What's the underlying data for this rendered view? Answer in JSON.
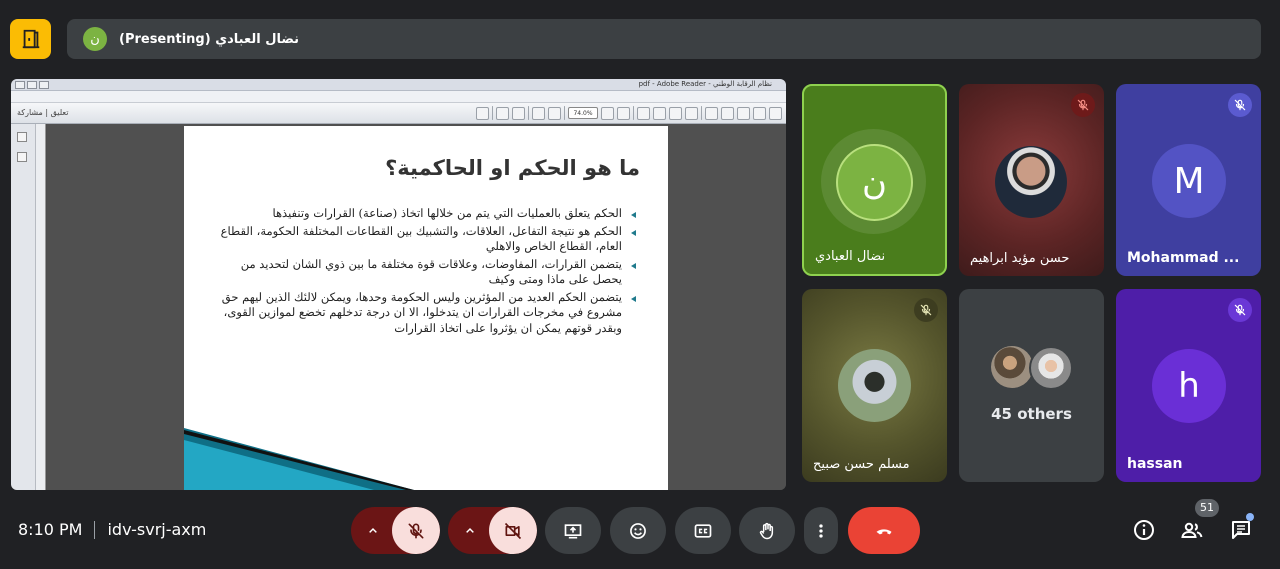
{
  "presenter_bar": {
    "avatar_letter": "ن",
    "text": "(Presenting) نضال العبادي"
  },
  "shared_screen": {
    "window_title": "pdf - Adobe Reader - نظام الرقابة الوطني",
    "toolbar_left": "تعليق | مشاركة",
    "zoom": "74.0%",
    "slide_title": "ما هو الحكم او الحاكمية؟",
    "bullets": [
      "الحكم يتعلق بالعمليات التي يتم من خلالها اتخاذ (صناعة) القرارات وتنفيذها",
      "الحكم هو نتيجة التفاعل، العلاقات، والتشبيك بين القطاعات المختلفة الحكومة، القطاع العام، القطاع الخاص والاهلي",
      "يتضمن القرارات، المفاوضات، وعلاقات قوة مختلفة ما بين ذوي الشان لتحديد من يحصل على ماذا ومتى وكيف",
      "يتضمن الحكم العديد من المؤثرين وليس الحكومة وحدها، ويمكن لالئك الذين ليهم حق مشروع في مخرجات القرارات ان يتدخلوا، الا ان درجة تدخلهم تخضع لموازين القوى، وبقدر قوتهم يمكن ان يؤثروا على اتخاذ القرارات"
    ]
  },
  "participants": [
    {
      "name": "نضال العبادي",
      "avatar": "ن",
      "muted": false,
      "active_speaker": true
    },
    {
      "name": "حسن مؤيد ابراهيم",
      "muted": true
    },
    {
      "name": "Mohammad ...",
      "avatar": "M",
      "muted": true
    },
    {
      "name": "مسلم حسن صبيح",
      "muted": true
    },
    {
      "others_label": "45 others"
    },
    {
      "name": "hassan",
      "avatar": "h",
      "muted": true
    }
  ],
  "bottom_bar": {
    "time": "8:10 PM",
    "meeting_code": "idv-svrj-axm",
    "people_count": "51"
  },
  "colors": {
    "accent_yellow": "#fbbc04",
    "hangup_red": "#ea4335",
    "active_speaker_green": "#8fd14f"
  }
}
